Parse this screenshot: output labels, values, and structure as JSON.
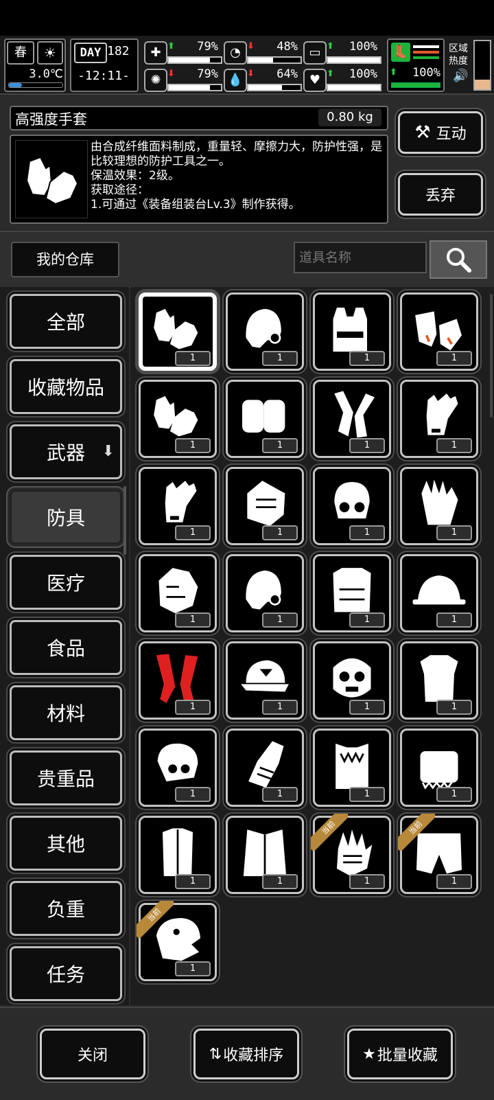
{
  "hud": {
    "season": "春",
    "temperature": "3.0℃",
    "day_label": "DAY",
    "day": "182",
    "time": "-12:11-",
    "stats": [
      {
        "icon": "medkit-icon",
        "dir": "up",
        "value": "79%",
        "fill": 0.79
      },
      {
        "icon": "stomach-icon",
        "dir": "down",
        "value": "48%",
        "fill": 0.48
      },
      {
        "icon": "capsule-icon",
        "dir": "up",
        "value": "100%",
        "fill": 1.0
      },
      {
        "icon": "brain-icon",
        "dir": "down",
        "value": "79%",
        "fill": 0.79
      },
      {
        "icon": "water-drop-icon",
        "dir": "down",
        "value": "64%",
        "fill": 0.64
      },
      {
        "icon": "heart-icon",
        "dir": "up",
        "value": "100%",
        "fill": 1.0
      }
    ],
    "boot_value": "100%",
    "zone_heat_label": "区域热度"
  },
  "item": {
    "name": "高强度手套",
    "weight": "0.80 kg",
    "description": "由合成纤维面料制成，重量轻、摩擦力大，防护性强，是比较理想的防护工具之一。",
    "warmth": "保温效果：2级。",
    "source_title": "获取途径：",
    "source": "1.可通过《装备组装台Lv.3》制作获得。"
  },
  "actions": {
    "interact": "互动",
    "discard": "丢弃"
  },
  "warehouse": {
    "title": "我的仓库",
    "search_placeholder": "道具名称"
  },
  "categories": [
    "全部",
    "收藏物品",
    "武器",
    "防具",
    "医疗",
    "食品",
    "材料",
    "贵重品",
    "其他",
    "负重",
    "任务"
  ],
  "grid": {
    "current_label": "当前",
    "items": [
      {
        "icon": "glove-pair-icon",
        "qty": "1"
      },
      {
        "icon": "helmet-icon",
        "qty": "1"
      },
      {
        "icon": "vest-icon",
        "qty": "1"
      },
      {
        "icon": "fingerless-glove-icon",
        "qty": "1"
      },
      {
        "icon": "glove-pair-icon",
        "qty": "1"
      },
      {
        "icon": "knee-pad-icon",
        "qty": "1"
      },
      {
        "icon": "arm-guard-icon",
        "qty": "1"
      },
      {
        "icon": "glove-icon",
        "qty": "1"
      },
      {
        "icon": "glove-icon",
        "qty": "1"
      },
      {
        "icon": "tactical-glove-icon",
        "qty": "1"
      },
      {
        "icon": "gas-mask-helmet-icon",
        "qty": "1"
      },
      {
        "icon": "padded-glove-icon",
        "qty": "1"
      },
      {
        "icon": "horse-mask-icon",
        "qty": "1"
      },
      {
        "icon": "helmet-icon",
        "qty": "1"
      },
      {
        "icon": "body-armor-icon",
        "qty": "1"
      },
      {
        "icon": "hard-hat-icon",
        "qty": "1"
      },
      {
        "icon": "red-leg-guard-icon",
        "qty": "1"
      },
      {
        "icon": "cap-icon",
        "qty": "1"
      },
      {
        "icon": "mutant-mask-icon",
        "qty": "1"
      },
      {
        "icon": "armor-vest-icon",
        "qty": "1"
      },
      {
        "icon": "skull-helmet-icon",
        "qty": "1"
      },
      {
        "icon": "gauntlet-icon",
        "qty": "1"
      },
      {
        "icon": "fur-vest-icon",
        "qty": "1"
      },
      {
        "icon": "fur-muff-icon",
        "qty": "1"
      },
      {
        "icon": "fur-coat-icon",
        "qty": "1"
      },
      {
        "icon": "long-coat-icon",
        "qty": "1"
      },
      {
        "icon": "scaled-glove-icon",
        "qty": "1",
        "current": true
      },
      {
        "icon": "torn-shorts-icon",
        "qty": "1",
        "current": true
      },
      {
        "icon": "dinosaur-mask-icon",
        "qty": "1",
        "current": true
      }
    ]
  },
  "bottom": {
    "close": "关闭",
    "sort_favorites": "收藏排序",
    "batch_favorite": "批量收藏"
  },
  "colors": {
    "up": "#2ecc40",
    "down": "#ff3030",
    "ribbon": "#b8893a",
    "red_item": "#e02020"
  }
}
